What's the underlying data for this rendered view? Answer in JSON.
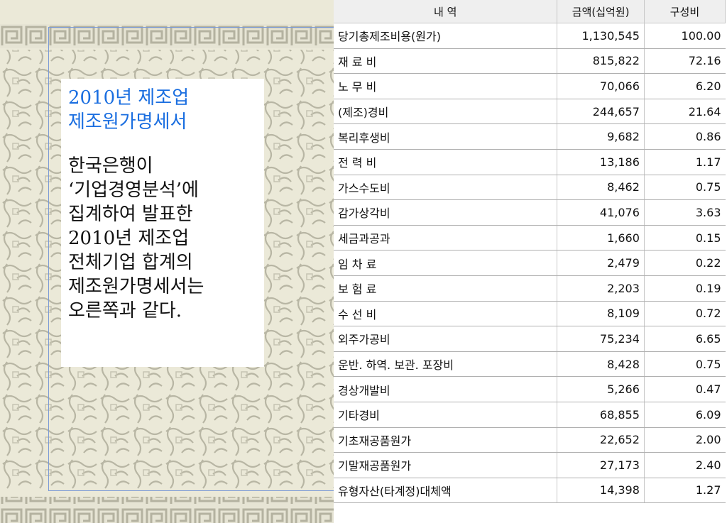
{
  "slide": {
    "title_lines": "2010년 제조업\n제조원가명세서",
    "body_lines": "한국은행이\n‘기업경영분석’에\n집계하여 발표한\n2010년 제조업\n전체기업 합계의\n제조원가명세서는\n오른쪽과 같다."
  },
  "table": {
    "headers": {
      "item": "내 역",
      "amount": "금액(십억원)",
      "ratio": "구성비"
    },
    "rows": [
      {
        "item": "당기총제조비용(원가)",
        "amount": "1,130,545",
        "ratio": "100.00"
      },
      {
        "item": "재 료 비",
        "amount": "815,822",
        "ratio": "72.16"
      },
      {
        "item": "노 무 비",
        "amount": "70,066",
        "ratio": "6.20"
      },
      {
        "item": "(제조)경비",
        "amount": "244,657",
        "ratio": "21.64"
      },
      {
        "item": "복리후생비",
        "amount": "9,682",
        "ratio": "0.86"
      },
      {
        "item": "전 력 비",
        "amount": "13,186",
        "ratio": "1.17"
      },
      {
        "item": "가스수도비",
        "amount": "8,462",
        "ratio": "0.75"
      },
      {
        "item": "감가상각비",
        "amount": "41,076",
        "ratio": "3.63"
      },
      {
        "item": "세금과공과",
        "amount": "1,660",
        "ratio": "0.15"
      },
      {
        "item": "임 차 료",
        "amount": "2,479",
        "ratio": "0.22"
      },
      {
        "item": "보 험 료",
        "amount": "2,203",
        "ratio": "0.19"
      },
      {
        "item": "수 선 비",
        "amount": "8,109",
        "ratio": "0.72"
      },
      {
        "item": "외주가공비",
        "amount": "75,234",
        "ratio": "6.65"
      },
      {
        "item": "운반. 하역. 보관. 포장비",
        "amount": "8,428",
        "ratio": "0.75"
      },
      {
        "item": "경상개발비",
        "amount": "5,266",
        "ratio": "0.47"
      },
      {
        "item": "기타경비",
        "amount": "68,855",
        "ratio": "6.09"
      },
      {
        "item": "기초재공품원가",
        "amount": "22,652",
        "ratio": "2.00"
      },
      {
        "item": "기말재공품원가",
        "amount": "27,173",
        "ratio": "2.40"
      },
      {
        "item": "유형자산(타계정)대체액",
        "amount": "14,398",
        "ratio": "1.27"
      }
    ]
  },
  "colors": {
    "title": "#1a6ee0",
    "background": "#ebe9d8",
    "frame": "#7a9ad6"
  }
}
